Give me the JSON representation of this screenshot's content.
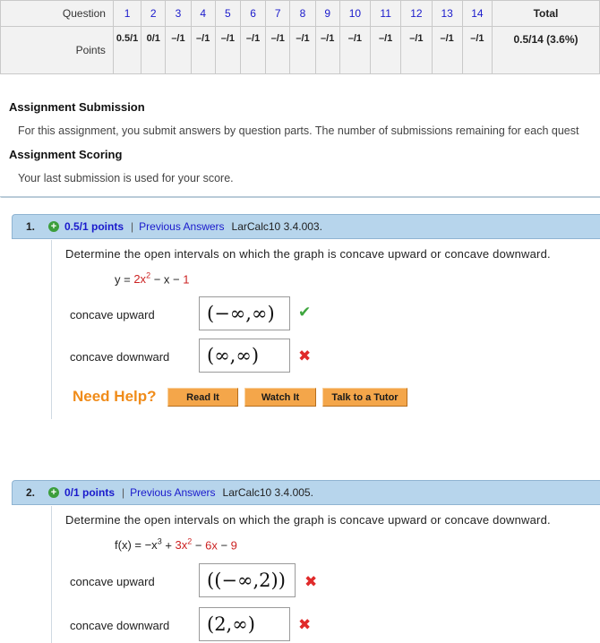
{
  "score_table": {
    "question_label": "Question",
    "points_label": "Points",
    "total_label": "Total",
    "questions": [
      "1",
      "2",
      "3",
      "4",
      "5",
      "6",
      "7",
      "8",
      "9",
      "10",
      "11",
      "12",
      "13",
      "14"
    ],
    "points": [
      "0.5/1",
      "0/1",
      "–/1",
      "–/1",
      "–/1",
      "–/1",
      "–/1",
      "–/1",
      "–/1",
      "–/1",
      "–/1",
      "–/1",
      "–/1",
      "–/1"
    ],
    "total": "0.5/14 (3.6%)"
  },
  "assignment": {
    "submission_heading": "Assignment Submission",
    "submission_text": "For this assignment, you submit answers by question parts. The number of submissions remaining for each quest",
    "scoring_heading": "Assignment Scoring",
    "scoring_text": "Your last submission is used for your score."
  },
  "questions": [
    {
      "number": "1.",
      "points": "0.5/1 points",
      "separator": "|",
      "previous_answers": "Previous Answers",
      "source": "LarCalc10 3.4.003.",
      "prompt": "Determine the open intervals on which the graph is concave upward or concave downward.",
      "function": {
        "lhs": "y = ",
        "t1": "2x",
        "t1_exp": "2",
        "t2": " − x − ",
        "t3": "1"
      },
      "answers": [
        {
          "label": "concave upward",
          "value": "(−∞,∞)",
          "correct": true
        },
        {
          "label": "concave downward",
          "value": "(∞,∞)",
          "correct": false
        }
      ],
      "help": {
        "need_help": "Need Help?",
        "read_it": "Read It",
        "watch_it": "Watch It",
        "tutor": "Talk to a Tutor"
      }
    },
    {
      "number": "2.",
      "points": "0/1 points",
      "separator": "|",
      "previous_answers": "Previous Answers",
      "source": "LarCalc10 3.4.005.",
      "prompt": "Determine the open intervals on which the graph is concave upward or concave downward.",
      "function": {
        "lhs": "f(x) = −x",
        "lhs_exp": "3",
        "t1": " + ",
        "t2": "3x",
        "t2_exp": "2",
        "t3": " − ",
        "t4": "6x",
        "t5": " − ",
        "t6": "9"
      },
      "answers": [
        {
          "label": "concave upward",
          "value": "((−∞,2))",
          "correct": false
        },
        {
          "label": "concave downward",
          "value": "(2,∞)",
          "correct": false
        }
      ]
    }
  ],
  "colors": {
    "header_bg": "#b7d5ec",
    "link": "#1a1acc",
    "correct": "#3ea63e",
    "wrong": "#e02a2a",
    "help": "#f08c1a"
  }
}
